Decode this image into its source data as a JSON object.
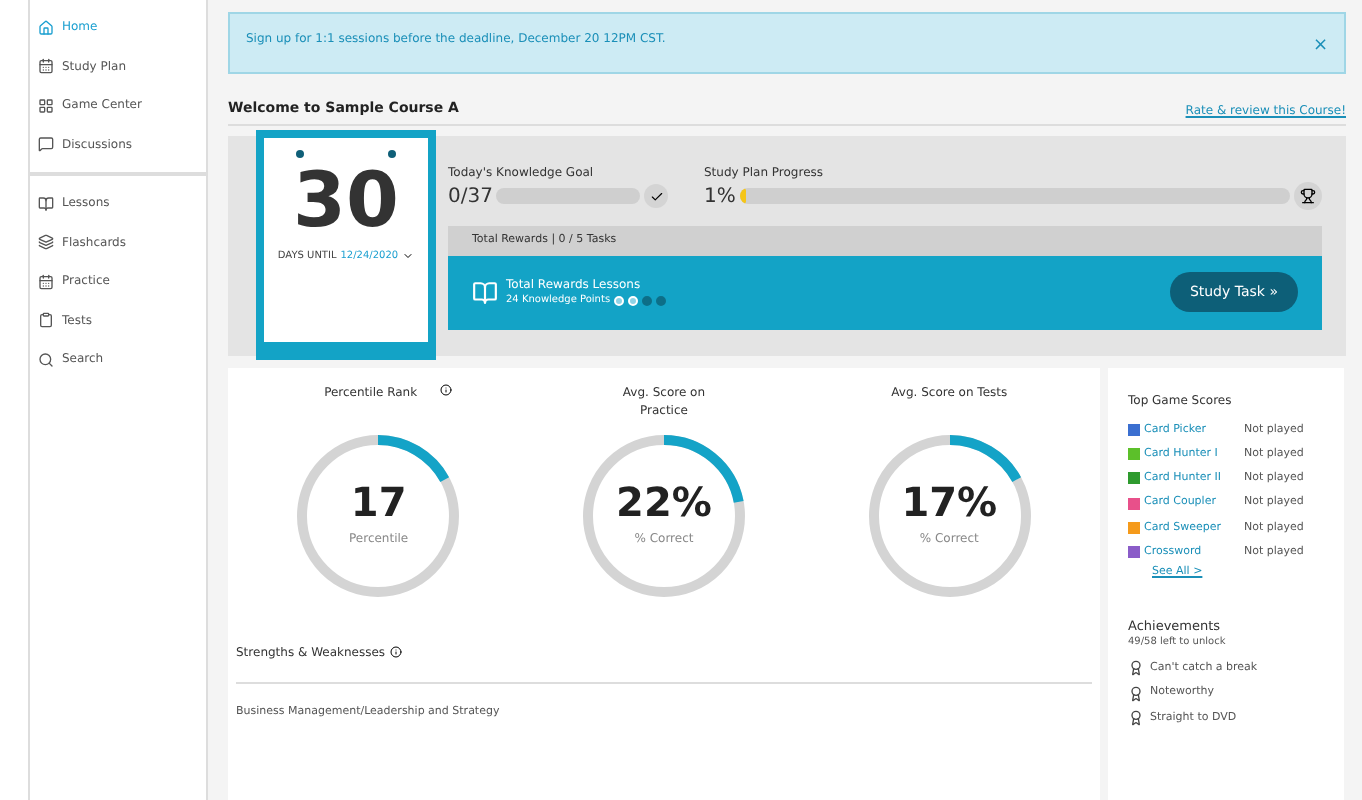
{
  "sidebar": {
    "sections": [
      {
        "items": [
          {
            "label": "Home",
            "selected": true
          },
          {
            "label": "Study Plan",
            "selected": false
          },
          {
            "label": "Game Center",
            "selected": false
          },
          {
            "label": "Discussions",
            "selected": false
          }
        ]
      },
      {
        "items": [
          {
            "label": "Lessons",
            "selected": false
          },
          {
            "label": "Flashcards",
            "selected": false
          },
          {
            "label": "Practice",
            "selected": false
          },
          {
            "label": "Tests",
            "selected": false
          },
          {
            "label": "Search",
            "selected": false
          }
        ]
      }
    ]
  },
  "banner": {
    "text": "Sign up for 1:1 sessions before the deadline, December 20 12PM CST.",
    "close": "×"
  },
  "welcome": {
    "title": "Welcome to Sample Course A",
    "link": "Rate & review this Course!"
  },
  "countdown": {
    "days": "30",
    "caption": "DAYS UNTIL",
    "date": "12/24/2020"
  },
  "knowledge_goal": {
    "label": "Today's Knowledge Goal",
    "value": "0/37",
    "level": 0
  },
  "study_plan": {
    "label": "Study Plan Progress",
    "value": "1%",
    "level": 0.01
  },
  "task": {
    "header": "Total Rewards | 0 / 5 Tasks",
    "title": "Total Rewards Lessons",
    "points": "24 Knowledge Points",
    "badges": [
      {
        "earned": true
      },
      {
        "earned": true
      },
      {
        "earned": false
      },
      {
        "earned": false
      }
    ],
    "button": "Study Task »"
  },
  "stats": [
    {
      "title": "Percentile Rank",
      "info": true,
      "value": "17",
      "caption": "Percentile",
      "level": 0.17
    },
    {
      "title": "Avg. Score on Practice",
      "info": false,
      "value": "22%",
      "caption": "% Correct",
      "level": 0.22
    },
    {
      "title": "Avg. Score on Tests",
      "info": false,
      "value": "17%",
      "caption": "% Correct",
      "level": 0.17
    }
  ],
  "strengths": {
    "title": "Strengths & Weaknesses",
    "rows": [
      "Business Management/Leadership and Strategy"
    ]
  },
  "games": {
    "title": "Top Game Scores",
    "items": [
      {
        "name": "Card Picker",
        "score": "Not played",
        "color": "#3b6fd0"
      },
      {
        "name": "Card Hunter I",
        "score": "Not played",
        "color": "#5cc02a"
      },
      {
        "name": "Card Hunter II",
        "score": "Not played",
        "color": "#2e9a2e"
      },
      {
        "name": "Card Coupler",
        "score": "Not played",
        "color": "#e8508a"
      },
      {
        "name": "Card Sweeper",
        "score": "Not played",
        "color": "#f59a1b"
      },
      {
        "name": "Crossword",
        "score": "Not played",
        "color": "#8a5cc8"
      }
    ],
    "more": "See All >"
  },
  "achievements": {
    "title": "Achievements",
    "subtitle": "49/58 left to unlock",
    "items": [
      "Can't catch a break",
      "Noteworthy",
      "Straight to DVD"
    ]
  }
}
